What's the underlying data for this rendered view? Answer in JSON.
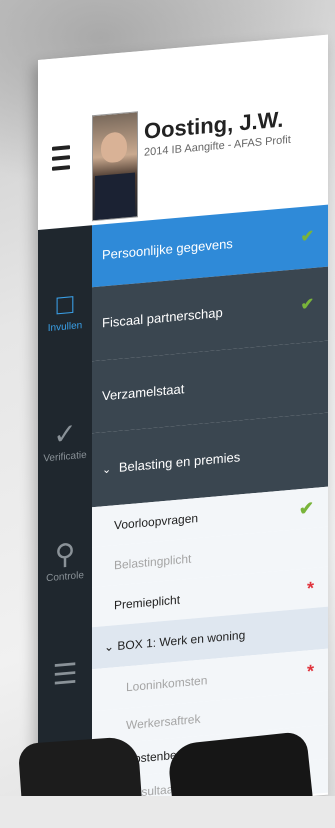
{
  "header": {
    "name": "Oosting, J.W.",
    "subtitle": "2014 IB Aangifte - AFAS Profit"
  },
  "rail": {
    "items": [
      {
        "label": "Invullen",
        "icon": "edit-icon"
      },
      {
        "label": "Verificatie",
        "icon": "check-icon"
      },
      {
        "label": "Controle",
        "icon": "search-icon"
      },
      {
        "label": "",
        "icon": "document-icon"
      }
    ]
  },
  "menu": {
    "sections": [
      {
        "label": "Persoonlijke gegevens",
        "status": "complete"
      },
      {
        "label": "Fiscaal partnerschap",
        "status": "complete"
      },
      {
        "label": "Verzamelstaat",
        "status": ""
      },
      {
        "label": "Belasting en premies",
        "status": "expanded"
      }
    ],
    "sub_items": [
      {
        "label": "Voorloopvragen",
        "mark": "✔"
      },
      {
        "label": "Belastingplicht",
        "mark": ""
      },
      {
        "label": "Premieplicht",
        "mark": "*"
      },
      {
        "label": "BOX 1: Werk en woning",
        "mark": ""
      },
      {
        "label": "Looninkomsten",
        "mark": "*"
      },
      {
        "label": "Werkersaftrek",
        "mark": ""
      },
      {
        "label": "Kostenbepaling",
        "mark": ""
      },
      {
        "label": "Resultaat uit overige",
        "mark": ""
      }
    ]
  },
  "colors": {
    "accent": "#2f8ad8",
    "complete": "#79b43a",
    "required": "#e0343d",
    "rail": "#1f272e",
    "section": "#3a4650"
  }
}
